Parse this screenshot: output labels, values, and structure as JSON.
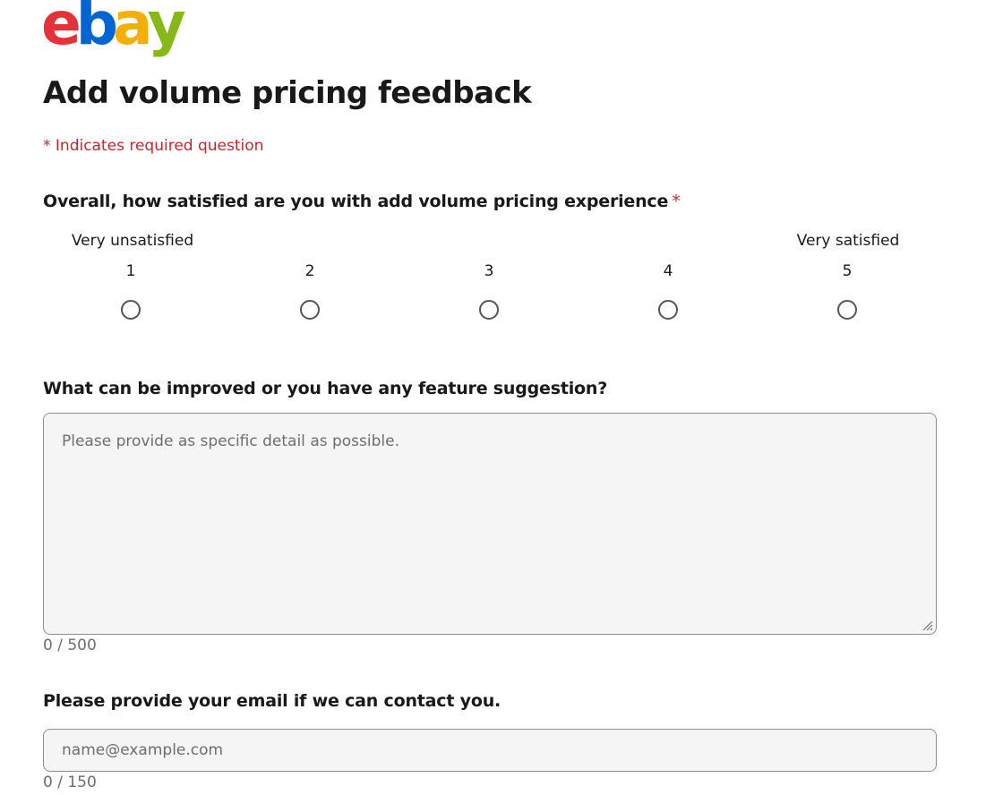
{
  "logo": {
    "letters": [
      "e",
      "b",
      "a",
      "y"
    ],
    "colors": [
      "#e53238",
      "#0064d2",
      "#f5af02",
      "#86b817"
    ]
  },
  "page_title": "Add volume pricing feedback",
  "required_note": "* Indicates required question",
  "question1": {
    "label": "Overall, how satisfied are you with add volume pricing experience",
    "required_mark": "*",
    "low_label": "Very unsatisfied",
    "high_label": "Very satisfied",
    "options": [
      "1",
      "2",
      "3",
      "4",
      "5"
    ]
  },
  "question2": {
    "label": "What can be improved or you have any feature suggestion?",
    "placeholder": "Please provide as specific detail as possible.",
    "counter": "0 / 500"
  },
  "question3": {
    "label": "Please provide your email if we can contact you.",
    "placeholder": "name@example.com",
    "counter": "0 / 150"
  },
  "colors": {
    "required": "#c7252d",
    "field_bg": "#f5f5f5",
    "field_border": "#8f8f8f"
  }
}
